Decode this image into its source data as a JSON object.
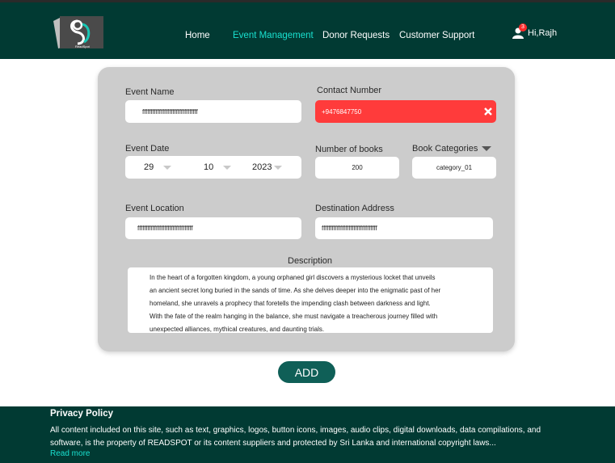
{
  "nav": {
    "logo_text": "ReadSpot",
    "items": [
      "Home",
      "Event Management",
      "Donor Requests",
      "Customer Support"
    ],
    "notification_count": "3",
    "greeting": "Hi,Rajh"
  },
  "form": {
    "event_name": {
      "label": "Event Name",
      "value": "fffffffffffffffffffffffffffffffff"
    },
    "contact_number": {
      "label": "Contact Number",
      "value": "+9476847750"
    },
    "event_date": {
      "label": "Event Date",
      "day": "29",
      "month": "10",
      "year": "2023"
    },
    "number_of_books": {
      "label": "Number of books",
      "value": "200"
    },
    "book_categories": {
      "label": "Book Categories",
      "value": "category_01"
    },
    "event_location": {
      "label": "Event Location",
      "value": "fffffffffffffffffffffffffffffffff"
    },
    "destination_address": {
      "label": "Destination Address",
      "value": "fffffffffffffffffffffffffffffffff"
    },
    "description": {
      "label": "Description",
      "lines": [
        "In the heart of a forgotten kingdom, a young orphaned girl discovers a mysterious locket that unveils",
        "an ancient secret long buried in the sands of time. As she delves deeper into the enigmatic past of her",
        "homeland, she unravels a prophecy that foretells the impending clash between darkness and light.",
        "With the fate of the realm hanging in the balance, she must navigate a treacherous journey filled with",
        "unexpected alliances, mythical creatures, and daunting trials."
      ]
    },
    "add_label": "ADD"
  },
  "footer": {
    "title": "Privacy Policy",
    "text": "All content included on this site, such as text, graphics, logos, button icons, images, audio clips, digital downloads, data compilations, and software, is the property of READSPOT or its content suppliers and protected by Sri Lanka and international copyright laws...",
    "read_more": "Read more"
  },
  "colors": {
    "header": "#013a33",
    "accent": "#19e0cf",
    "error": "#ff3b3b",
    "button": "#0f5f57"
  }
}
